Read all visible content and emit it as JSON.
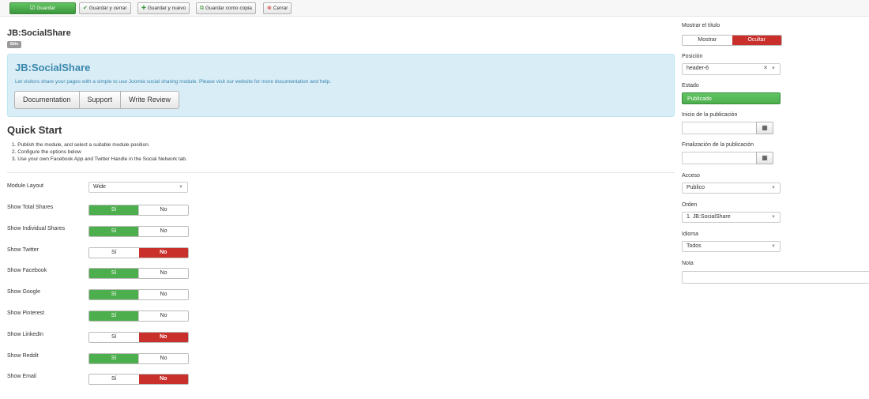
{
  "toolbar": {
    "save_label": "Guardar",
    "save_close_label": "Guardar y cerrar",
    "save_new_label": "Guardar y nuevo",
    "save_copy_label": "Guardar como copia",
    "close_label": "Cerrar"
  },
  "page": {
    "title": "JB:SocialShare",
    "badge": "Sitio"
  },
  "info": {
    "title": "JB:SocialShare",
    "description": "Let visitors share your pages with a simple to use Joomla social sharing module. Please visit our website for more documentation and help.",
    "buttons": [
      "Documentation",
      "Support",
      "Write Review"
    ]
  },
  "quick_start": {
    "title": "Quick Start",
    "steps": [
      "1. Publish the module, and select a suitable module position.",
      "2. Configure the options below",
      "3. Use your own Facebook App and Twitter Handle in the Social Network tab."
    ]
  },
  "options": {
    "module_layout": {
      "label": "Module Layout",
      "value": "Wide"
    },
    "yes_label": "Sí",
    "no_label": "No",
    "toggles": [
      {
        "label": "Show Total Shares",
        "state": "yes"
      },
      {
        "label": "Show Individual Shares",
        "state": "yes"
      },
      {
        "label": "Show Twitter",
        "state": "no"
      },
      {
        "label": "Show Facebook",
        "state": "yes"
      },
      {
        "label": "Show Google",
        "state": "yes"
      },
      {
        "label": "Show Pinterest",
        "state": "yes"
      },
      {
        "label": "Show LinkedIn",
        "state": "no"
      },
      {
        "label": "Show Reddit",
        "state": "yes"
      },
      {
        "label": "Show Email",
        "state": "no"
      }
    ]
  },
  "sidebar": {
    "show_title": {
      "label": "Mostrar el título",
      "show": "Mostrar",
      "hide": "Ocultar",
      "selected": "hide"
    },
    "position": {
      "label": "Posición",
      "value": "header-6"
    },
    "status": {
      "label": "Estado",
      "value": "Publicado"
    },
    "publish_up": {
      "label": "Inicio de la publicación",
      "value": ""
    },
    "publish_down": {
      "label": "Finalización de la publicación",
      "value": ""
    },
    "access": {
      "label": "Acceso",
      "value": "Publico"
    },
    "ordering": {
      "label": "Orden",
      "value": "1. JB:SocialShare"
    },
    "language": {
      "label": "Idioma",
      "value": "Todos"
    },
    "note": {
      "label": "Nota",
      "value": ""
    }
  },
  "colors": {
    "green": "#4cae4c",
    "red": "#c9302c",
    "info_bg": "#d9edf7",
    "info_text": "#3a87ad"
  }
}
